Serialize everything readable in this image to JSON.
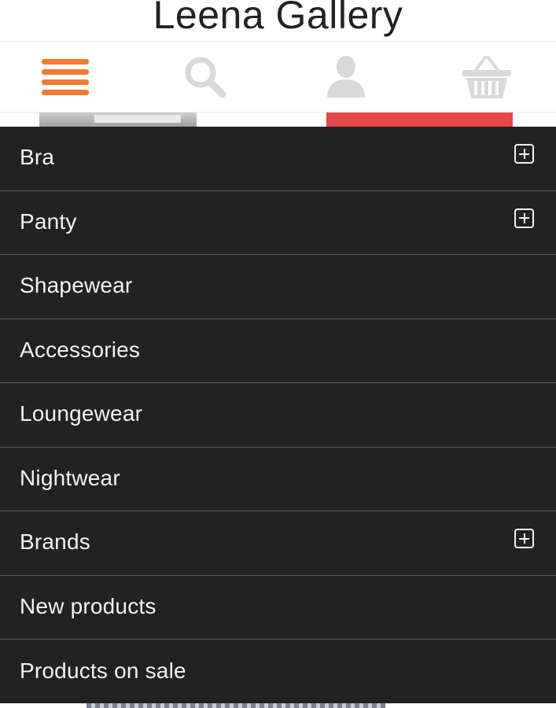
{
  "header": {
    "site_title": "Leena Gallery"
  },
  "toolbar": {
    "items": [
      {
        "icon": "hamburger-menu-icon",
        "active": true,
        "color": "#f07a32"
      },
      {
        "icon": "search-icon",
        "color": "#d9d9d9"
      },
      {
        "icon": "account-icon",
        "color": "#d9d9d9"
      },
      {
        "icon": "shopping-basket-icon",
        "color": "#d9d9d9"
      }
    ]
  },
  "menu": {
    "items": [
      {
        "label": "Bra",
        "expandable": true
      },
      {
        "label": "Panty",
        "expandable": true
      },
      {
        "label": "Shapewear",
        "expandable": false
      },
      {
        "label": "Accessories",
        "expandable": false
      },
      {
        "label": "Loungewear",
        "expandable": false
      },
      {
        "label": "Nightwear",
        "expandable": false
      },
      {
        "label": "Brands",
        "expandable": true
      },
      {
        "label": "New products",
        "expandable": false
      },
      {
        "label": "Products on sale",
        "expandable": false
      }
    ]
  },
  "colors": {
    "accent": "#f07a32",
    "drawer_background": "#222222",
    "menu_text": "#f2f2f2",
    "icon_inactive": "#d9d9d9",
    "banner_red": "#e5474b"
  }
}
